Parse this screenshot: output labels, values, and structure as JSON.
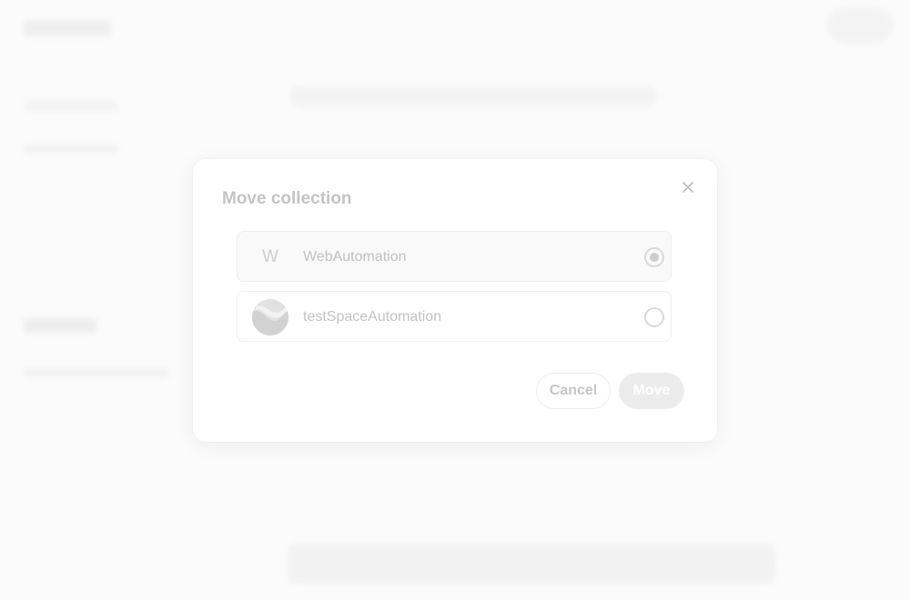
{
  "dialog": {
    "title": "Move collection",
    "close_icon": "close-icon",
    "options": [
      {
        "avatar_letter": "W",
        "label": "WebAutomation",
        "selected": true
      },
      {
        "avatar_icon": "space-avatar-image",
        "label": "testSpaceAutomation",
        "selected": false
      }
    ],
    "cancel_label": "Cancel",
    "move_label": "Move"
  },
  "colors": {
    "modal_bg": "#ffffff",
    "backdrop": "#fbfbfb",
    "move_button_bg": "#ececec"
  }
}
